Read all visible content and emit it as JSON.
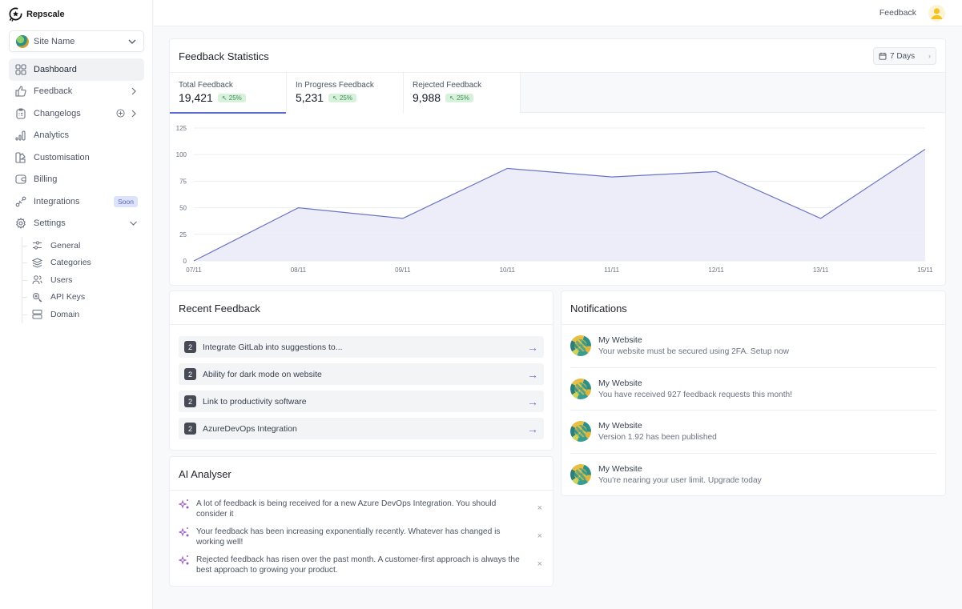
{
  "brand": {
    "name": "Repscale"
  },
  "site_selector": {
    "label": "Site Name"
  },
  "sidebar": {
    "items": [
      {
        "label": "Dashboard",
        "icon": "dashboard-icon",
        "active": true
      },
      {
        "label": "Feedback",
        "icon": "thumbs-up-icon",
        "chevron": "right"
      },
      {
        "label": "Changelogs",
        "icon": "clipboard-icon",
        "chevron": "right",
        "add": true
      },
      {
        "label": "Analytics",
        "icon": "bar-chart-icon"
      },
      {
        "label": "Customisation",
        "icon": "palette-icon"
      },
      {
        "label": "Billing",
        "icon": "wallet-icon"
      },
      {
        "label": "Integrations",
        "icon": "integration-icon",
        "badge": "Soon"
      },
      {
        "label": "Settings",
        "icon": "gear-icon",
        "chevron": "down"
      }
    ],
    "settings_sub": [
      {
        "label": "General",
        "icon": "sliders-icon"
      },
      {
        "label": "Categories",
        "icon": "layers-icon"
      },
      {
        "label": "Users",
        "icon": "users-icon"
      },
      {
        "label": "API Keys",
        "icon": "key-icon"
      },
      {
        "label": "Domain",
        "icon": "server-icon"
      }
    ]
  },
  "topbar": {
    "feedback_link": "Feedback",
    "avatar": "user-avatar"
  },
  "stats": {
    "title": "Feedback Statistics",
    "range": "7 Days",
    "tabs": [
      {
        "label": "Total Feedback",
        "value": "19,421",
        "change": "↖ 25%",
        "active": true
      },
      {
        "label": "In Progress Feedback",
        "value": "5,231",
        "change": "↖ 25%"
      },
      {
        "label": "Rejected Feedback",
        "value": "9,988",
        "change": "↖ 25%"
      }
    ]
  },
  "chart_data": {
    "type": "area",
    "title": "",
    "xlabel": "",
    "ylabel": "",
    "categories": [
      "07/11",
      "08/11",
      "09/11",
      "10/11",
      "11/11",
      "12/11",
      "13/11",
      "15/11"
    ],
    "series": [
      {
        "name": "Total Feedback",
        "values": [
          0,
          50,
          40,
          87,
          79,
          84,
          40,
          105
        ]
      }
    ],
    "ylim": [
      0,
      125
    ],
    "yticks": [
      0,
      25,
      50,
      75,
      100,
      125
    ],
    "grid": true,
    "legend": "none",
    "colors": {
      "line": "#6b74c4",
      "fill": "#eaebf8",
      "grid": "#eceef1"
    }
  },
  "recent_feedback": {
    "title": "Recent Feedback",
    "items": [
      {
        "count": "2",
        "text": "Integrate GitLab into suggestions to..."
      },
      {
        "count": "2",
        "text": "Ability for dark mode on website"
      },
      {
        "count": "2",
        "text": "Link to productivity software"
      },
      {
        "count": "2",
        "text": "AzureDevOps Integration"
      }
    ]
  },
  "ai_analyser": {
    "title": "AI Analyser",
    "items": [
      {
        "text": "A lot of feedback is being received for a new Azure DevOps Integration. You should consider it"
      },
      {
        "text": "Your feedback has been increasing exponentially recently. Whatever has changed is working well!"
      },
      {
        "text": "Rejected feedback has risen over the past month. A customer-first approach is always the best approach to growing your product."
      }
    ],
    "close_glyph": "×"
  },
  "notifications": {
    "title": "Notifications",
    "items": [
      {
        "title": "My Website",
        "message": "Your website must be secured using 2FA. Setup now"
      },
      {
        "title": "My Website",
        "message": "You have received 927 feedback requests this month!"
      },
      {
        "title": "My Website",
        "message": "Version 1.92 has been published"
      },
      {
        "title": "My Website",
        "message": "You're nearing your user limit. Upgrade today"
      }
    ]
  }
}
